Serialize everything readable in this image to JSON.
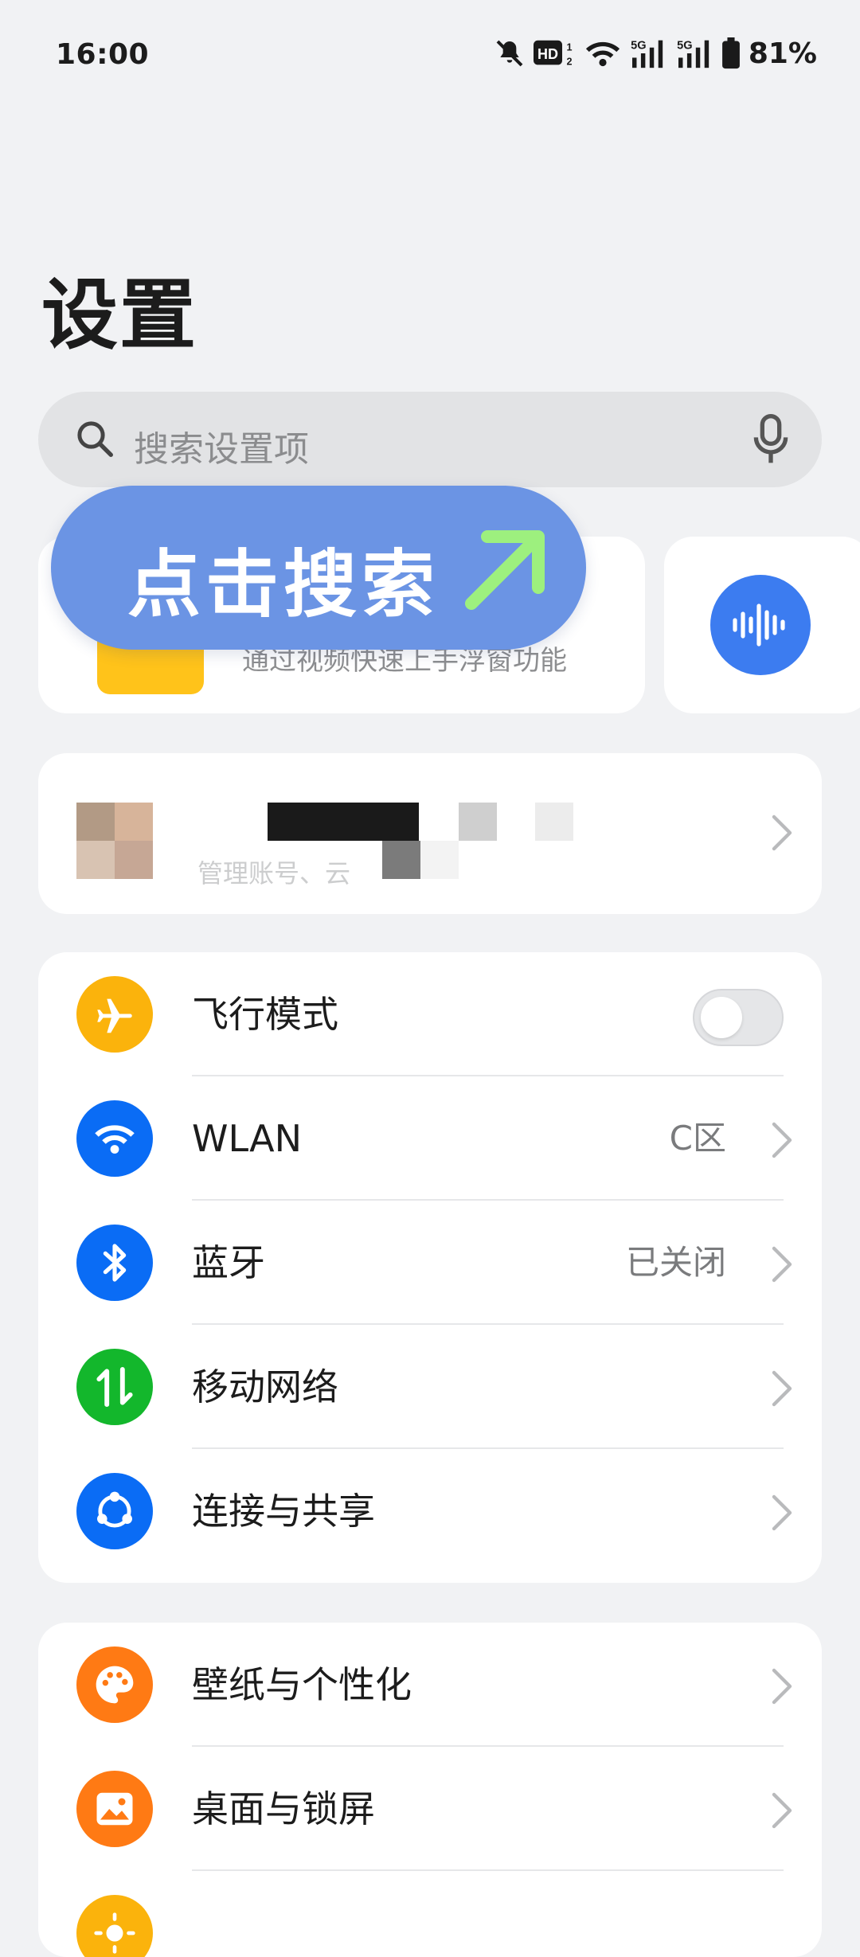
{
  "status_bar": {
    "time": "16:00",
    "battery": "81%",
    "icons": [
      "bell-muted-icon",
      "hd-icon",
      "wifi-icon",
      "5g-signal-icon",
      "5g-signal-icon",
      "battery-icon"
    ]
  },
  "page": {
    "title": "设置"
  },
  "search": {
    "placeholder": "搜索设置项"
  },
  "tip_card": {
    "subtitle": "通过视频快速上手浮窗功能"
  },
  "overlay": {
    "text": "点击搜索"
  },
  "account": {
    "subtitle": "管理账号、云"
  },
  "groups": [
    {
      "items": [
        {
          "label": "飞行模式",
          "value": "",
          "icon": "airplane-icon",
          "color": "#fbb30c",
          "control": "toggle",
          "toggle_on": false
        },
        {
          "label": "WLAN",
          "value": "C区",
          "icon": "wifi-icon",
          "color": "#0a6cf5",
          "control": "chevron"
        },
        {
          "label": "蓝牙",
          "value": "已关闭",
          "icon": "bluetooth-icon",
          "color": "#0a6cf5",
          "control": "chevron"
        },
        {
          "label": "移动网络",
          "value": "",
          "icon": "mobile-data-icon",
          "color": "#13b72c",
          "control": "chevron"
        },
        {
          "label": "连接与共享",
          "value": "",
          "icon": "share-icon",
          "color": "#0a6cf5",
          "control": "chevron"
        }
      ]
    },
    {
      "items": [
        {
          "label": "壁纸与个性化",
          "value": "",
          "icon": "palette-icon",
          "color": "#ff7a14",
          "control": "chevron"
        },
        {
          "label": "桌面与锁屏",
          "value": "",
          "icon": "picture-icon",
          "color": "#ff7a14",
          "control": "chevron"
        },
        {
          "label": "",
          "value": "",
          "icon": "sun-icon",
          "color": "#fbb30c",
          "control": "chevron"
        }
      ]
    }
  ]
}
